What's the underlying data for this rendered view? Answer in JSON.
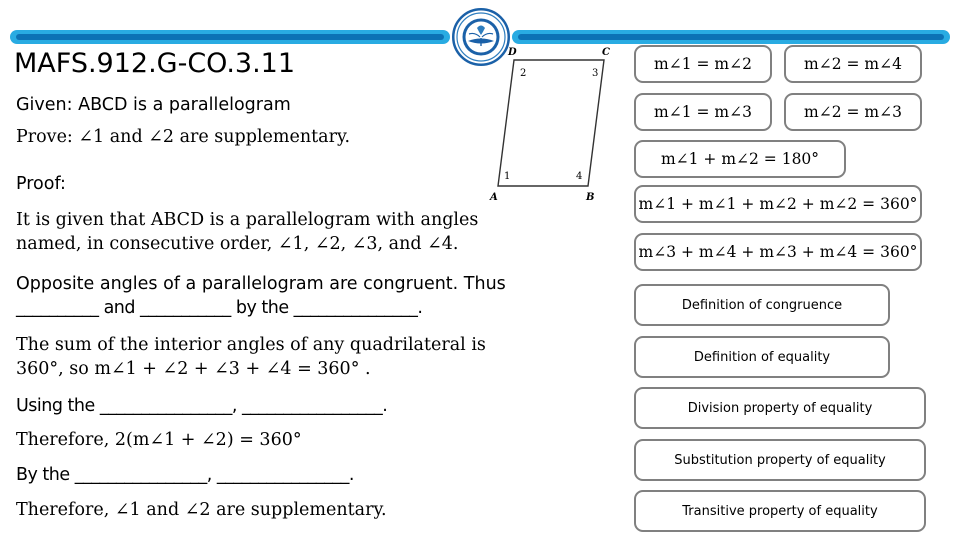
{
  "header": {
    "bar_color_outer": "#29ABE2",
    "bar_color_inner": "#0C72B5",
    "logo_name": "school-seal-logo"
  },
  "title": "MAFS.912.G-CO.3.11",
  "proof": {
    "given_line": "Given: ABCD is a parallelogram",
    "prove_line": "Prove: ∠1 and ∠2 are supplementary.",
    "proof_label": "Proof:",
    "step1_line1": "It is given that ABCD is a parallelogram with angles",
    "step1_line2": "named, in consecutive order, ∠1, ∠2, ∠3, and ∠4.",
    "step2_line1": "Opposite angles of a parallelogram are congruent. Thus",
    "step2_line2": "__________ and ___________ by the _______________.",
    "step3_line1": "The sum of the interior angles of any quadrilateral is",
    "step3_line2": "360°, so m∠1 + ∠2 + ∠3 + ∠4 = 360° .",
    "step4_line": "Using the ________________, _________________.",
    "step5_line": "Therefore, 2(m∠1 + ∠2) = 360°",
    "step6_line": "By the ________________, ________________.",
    "step7_line": "Therefore, ∠1 and ∠2 are supplementary."
  },
  "figure": {
    "name": "parallelogram-abcd",
    "vertex_labels": [
      "D",
      "C",
      "A",
      "B"
    ],
    "angle_labels": [
      "2",
      "3",
      "1",
      "4"
    ]
  },
  "answer_boxes": {
    "border_color": "#808080",
    "equations": [
      {
        "id": "eq-1",
        "text": "m∠1 = m∠2"
      },
      {
        "id": "eq-2",
        "text": "m∠2 = m∠4"
      },
      {
        "id": "eq-3",
        "text": "m∠1 = m∠3"
      },
      {
        "id": "eq-4",
        "text": "m∠2 = m∠3"
      },
      {
        "id": "eq-5",
        "text": "m∠1 + m∠2 = 180°"
      },
      {
        "id": "eq-6",
        "text": "m∠1 + m∠1 + m∠2 + m∠2 = 360°"
      },
      {
        "id": "eq-7",
        "text": "m∠3 + m∠4 + m∠3 + m∠4 = 360°"
      }
    ],
    "properties": [
      {
        "id": "prop-1",
        "text": "Definition of congruence"
      },
      {
        "id": "prop-2",
        "text": "Definition of equality"
      },
      {
        "id": "prop-3",
        "text": "Division property of equality"
      },
      {
        "id": "prop-4",
        "text": "Substitution property of equality"
      },
      {
        "id": "prop-5",
        "text": "Transitive property of equality"
      }
    ]
  }
}
